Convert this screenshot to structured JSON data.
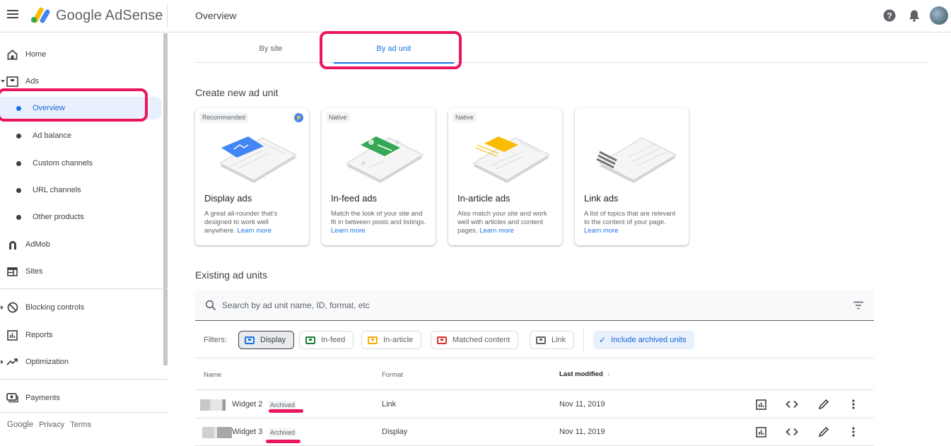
{
  "header": {
    "brand": "Google AdSense",
    "page_title": "Overview"
  },
  "sidebar": {
    "items": [
      {
        "label": "Home",
        "icon": "home-icon"
      },
      {
        "label": "Ads",
        "icon": "ads-icon"
      },
      {
        "label": "Overview"
      },
      {
        "label": "Ad balance"
      },
      {
        "label": "Custom channels"
      },
      {
        "label": "URL channels"
      },
      {
        "label": "Other products"
      },
      {
        "label": "AdMob",
        "icon": "admob-icon"
      },
      {
        "label": "Sites",
        "icon": "sites-icon"
      },
      {
        "label": "Blocking controls",
        "icon": "block-icon"
      },
      {
        "label": "Reports",
        "icon": "reports-icon"
      },
      {
        "label": "Optimization",
        "icon": "trending-icon"
      },
      {
        "label": "Payments",
        "icon": "payments-icon"
      }
    ],
    "footer": {
      "google": "Google",
      "privacy": "Privacy",
      "terms": "Terms"
    }
  },
  "tabs": [
    {
      "label": "By site",
      "active": false
    },
    {
      "label": "By ad unit",
      "active": true
    }
  ],
  "create_section": {
    "title": "Create new ad unit",
    "cards": [
      {
        "tag": "Recommended",
        "title": "Display ads",
        "desc": "A great all-rounder that’s designed to work well anywhere.",
        "link": "Learn more",
        "color": "#4285f4"
      },
      {
        "tag": "Native",
        "title": "In-feed ads",
        "desc": "Match the look of your site and fit in between posts and listings.",
        "link": "Learn more",
        "color": "#34a853"
      },
      {
        "tag": "Native",
        "title": "In-article ads",
        "desc": "Also match your site and work well with articles and content pages.",
        "link": "Learn more",
        "color": "#fbbc04"
      },
      {
        "tag": "",
        "title": "Link ads",
        "desc": "A list of topics that are relevant to the content of your page.",
        "link": "Learn more",
        "color": "#757575"
      }
    ]
  },
  "existing_section": {
    "title": "Existing ad units",
    "search_placeholder": "Search by ad unit name, ID, format, etc",
    "filters_label": "Filters:",
    "filters": [
      {
        "label": "Display",
        "color": "#1a73e8",
        "selected": true
      },
      {
        "label": "In-feed",
        "color": "#188038",
        "selected": false
      },
      {
        "label": "In-article",
        "color": "#f9ab00",
        "selected": false
      },
      {
        "label": "Matched content",
        "color": "#d93025",
        "selected": false
      },
      {
        "label": "Link",
        "color": "#5f6368",
        "selected": false
      }
    ],
    "archived_toggle": "Include archived units",
    "columns": {
      "name": "Name",
      "format": "Format",
      "modified": "Last modified"
    },
    "rows": [
      {
        "name": "Widget 2",
        "badge": "Archived",
        "format": "Link",
        "modified": "Nov 11, 2019"
      },
      {
        "name": "Widget 3",
        "badge": "Archived",
        "format": "Display",
        "modified": "Nov 11, 2019"
      }
    ]
  },
  "colors": {
    "accent": "#1a73e8",
    "highlight": "#ec155b"
  }
}
